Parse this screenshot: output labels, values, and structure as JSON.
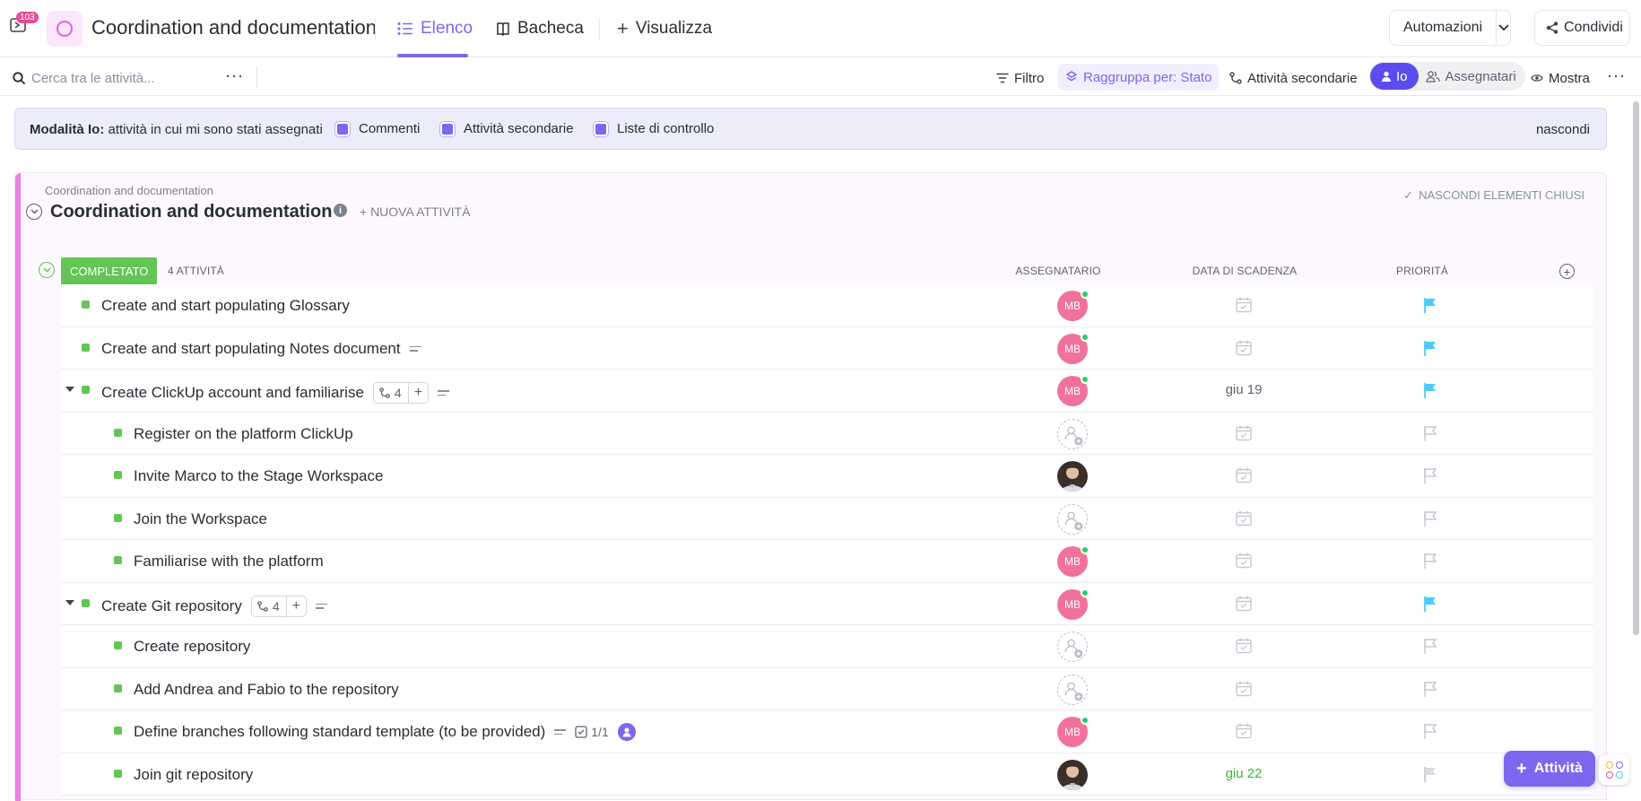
{
  "topbar": {
    "inbox_count": "103",
    "title": "Coordination and documentation",
    "tabs": [
      {
        "label": "Elenco",
        "icon": "list-icon",
        "active": true
      },
      {
        "label": "Bacheca",
        "icon": "board-icon",
        "active": false
      },
      {
        "label": "Visualizza",
        "icon": "plus-icon",
        "active": false
      }
    ],
    "automations_label": "Automazioni",
    "share_label": "Condividi"
  },
  "toolbar": {
    "search_placeholder": "Cerca tra le attività...",
    "filter_label": "Filtro",
    "group_label": "Raggruppa per: Stato",
    "subtasks_label": "Attività secondarie",
    "me_label": "Io",
    "assignees_label": "Assegnatari",
    "show_label": "Mostra"
  },
  "banner": {
    "mode_label": "Modalità Io:",
    "mode_text": " attività in cui mi sono stati assegnati",
    "options": [
      "Commenti",
      "Attività secondarie",
      "Liste di controllo"
    ],
    "hide_label": "nascondi"
  },
  "list": {
    "breadcrumb": "Coordination and documentation",
    "title": "Coordination and documentation",
    "new_task_label": "+ NUOVA ATTIVITÀ",
    "hide_closed_label": "NASCONDI ELEMENTI CHIUSI",
    "status": "COMPLETATO",
    "task_count": "4 ATTIVITÀ",
    "columns": {
      "assignee": "ASSEGNATARIO",
      "due": "DATA DI SCADENZA",
      "priority": "PRIORITÀ"
    }
  },
  "tasks": [
    {
      "name": "Create and start populating Glossary",
      "level": 0,
      "assignee": "MB",
      "due": "",
      "priority": "urgent"
    },
    {
      "name": "Create and start populating Notes document",
      "level": 0,
      "assignee": "MB",
      "due": "",
      "priority": "urgent",
      "description": true
    },
    {
      "name": "Create ClickUp account and familiarise",
      "level": 0,
      "assignee": "MB",
      "due": "giu 19",
      "priority": "urgent",
      "expanded": true,
      "subtasks": "4",
      "description": true
    },
    {
      "name": "Register on the platform ClickUp",
      "level": 1,
      "assignee": "",
      "due": "",
      "priority": "none"
    },
    {
      "name": "Invite Marco to the Stage Workspace",
      "level": 1,
      "assignee": "photo",
      "due": "",
      "priority": "none"
    },
    {
      "name": "Join the Workspace",
      "level": 1,
      "assignee": "",
      "due": "",
      "priority": "none"
    },
    {
      "name": "Familiarise with the platform",
      "level": 1,
      "assignee": "MB",
      "due": "",
      "priority": "none"
    },
    {
      "name": "Create Git repository",
      "level": 0,
      "assignee": "MB",
      "due": "",
      "priority": "urgent",
      "expanded": true,
      "subtasks": "4",
      "description": true
    },
    {
      "name": "Create repository",
      "level": 1,
      "assignee": "",
      "due": "",
      "priority": "none"
    },
    {
      "name": "Add Andrea and Fabio to the repository",
      "level": 1,
      "assignee": "",
      "due": "",
      "priority": "none"
    },
    {
      "name": "Define branches following standard template (to be provided)",
      "level": 1,
      "assignee": "MB",
      "due": "",
      "priority": "none",
      "description": true,
      "checklist": "1/1",
      "me_badge": true
    },
    {
      "name": "Join git repository",
      "level": 1,
      "assignee": "photo",
      "due": "giu 22",
      "due_color": "green",
      "priority": "low"
    }
  ],
  "fab_label": "Attività",
  "colors": {
    "accent": "#7b68ee",
    "status_complete": "#62c554",
    "list_color": "#ea7fe4",
    "urgent_flag": "#49ccf9",
    "avatar": "#f0729c"
  }
}
